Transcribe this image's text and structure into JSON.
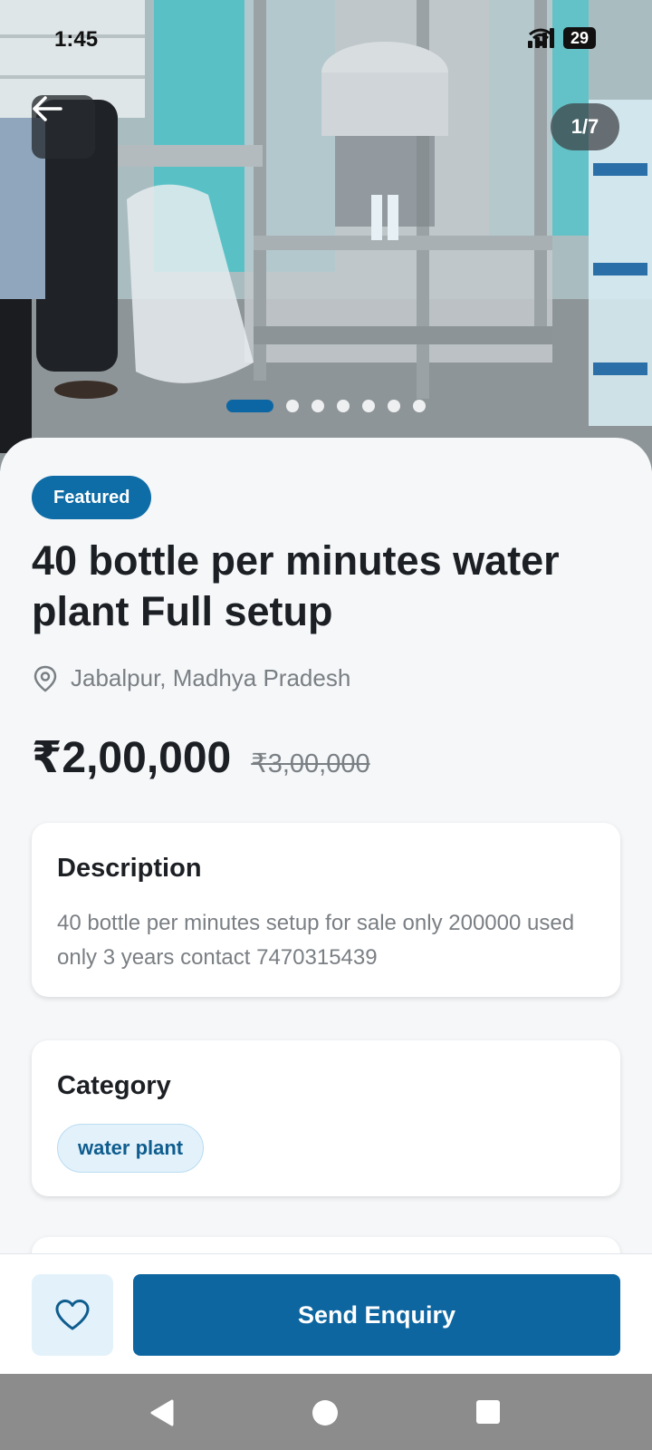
{
  "status_bar": {
    "time": "1:45",
    "battery": "29",
    "icons": [
      "signal-icon",
      "wifi-icon",
      "battery-icon"
    ]
  },
  "gallery": {
    "counter": "1/7",
    "total_images": 7,
    "active_index": 0,
    "back_icon": "arrow-left-icon"
  },
  "listing": {
    "badge": "Featured",
    "title": "40 bottle per minutes water plant Full setup",
    "location": "Jabalpur, Madhya Pradesh",
    "location_icon": "location-pin-icon",
    "price": "₹2,00,000",
    "original_price": "₹3,00,000"
  },
  "description": {
    "heading": "Description",
    "text": "40 bottle per minutes setup for sale only 200000 used only 3 years contact 7470315439"
  },
  "category": {
    "heading": "Category",
    "chip": "water plant"
  },
  "actions": {
    "favorite_icon": "heart-icon",
    "enquiry_label": "Send Enquiry"
  },
  "nav_bar": {
    "icons": [
      "back-triangle-icon",
      "home-circle-icon",
      "recents-square-icon"
    ]
  },
  "colors": {
    "accent": "#0e66a0",
    "badge": "#0e6ca6",
    "chip_bg": "#e3f1fb",
    "muted_text": "#7a7f84"
  }
}
